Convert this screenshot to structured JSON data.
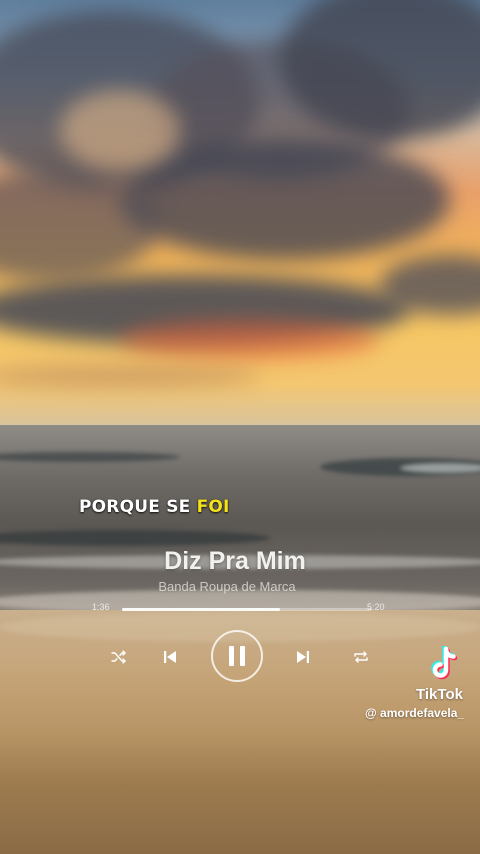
{
  "lyric": {
    "prefix": "PORQUE SE ",
    "highlight": "FOI"
  },
  "player": {
    "title": "Diz Pra Mim",
    "artist": "Banda Roupa de Marca",
    "time_elapsed": "1:36",
    "time_total": "5:20",
    "progress": 0.63,
    "state": "playing"
  },
  "watermark": {
    "brand": "TikTok",
    "handle": "@ amordefavela_"
  },
  "colors": {
    "lyric_highlight": "#f3e11a",
    "tiktok_cyan": "#25f4ee",
    "tiktok_red": "#fe2c55"
  },
  "icons": [
    "shuffle-icon",
    "previous-icon",
    "pause-icon",
    "next-icon",
    "repeat-icon",
    "tiktok-logo-icon"
  ]
}
